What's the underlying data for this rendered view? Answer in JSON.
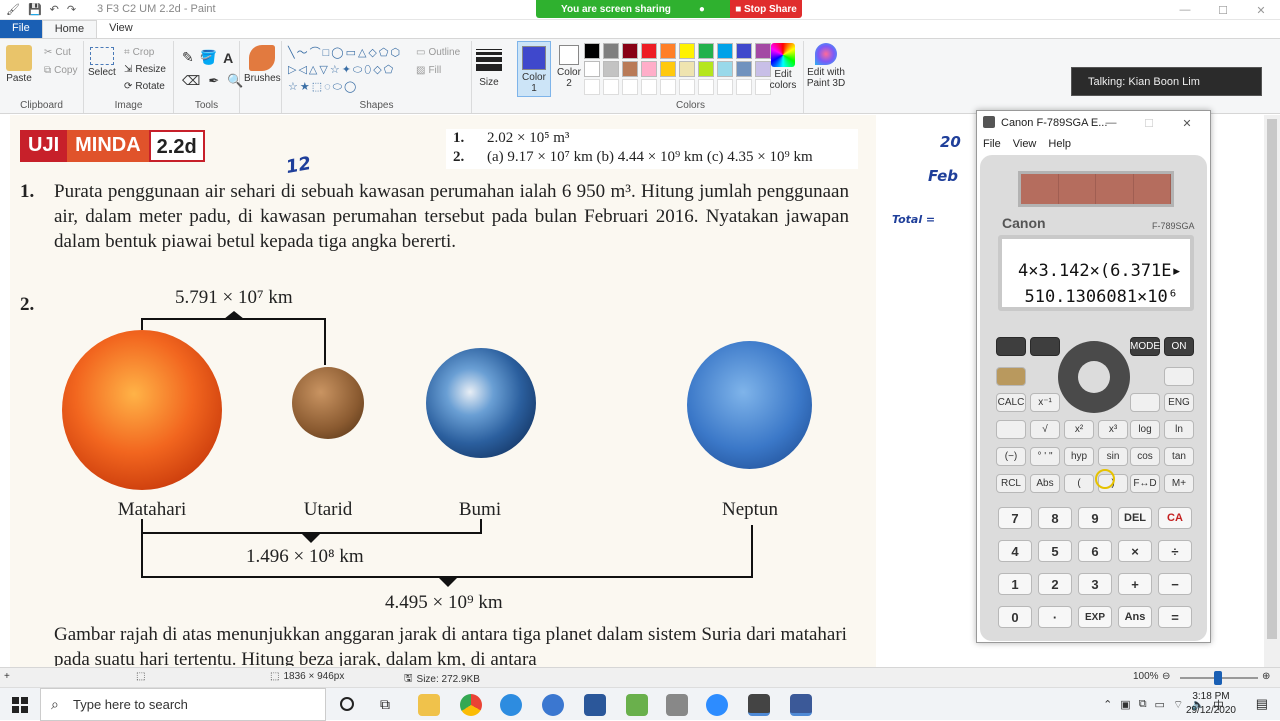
{
  "window": {
    "title": "3 F3 C2 UM 2.2d - Paint",
    "controls": [
      "—",
      "☐",
      "✕"
    ]
  },
  "screen_share": {
    "status": "You are screen sharing",
    "stop_label": "Stop Share"
  },
  "tabs": [
    "File",
    "Home",
    "View"
  ],
  "ribbon": {
    "clipboard": {
      "label": "Clipboard",
      "paste": "Paste",
      "cut": "Cut",
      "copy": "Copy"
    },
    "image": {
      "label": "Image",
      "select": "Select",
      "crop": "Crop",
      "resize": "Resize",
      "rotate": "Rotate"
    },
    "tools": {
      "label": "Tools"
    },
    "brushes": "Brushes",
    "shapes": {
      "label": "Shapes",
      "outline": "Outline",
      "fill": "Fill"
    },
    "size": "Size",
    "color1": "Color\n1",
    "color2": "Color\n2",
    "colors": {
      "label": "Colors",
      "edit": "Edit colors",
      "paint3d": "Edit with Paint 3D"
    },
    "palette": [
      "#000000",
      "#7f7f7f",
      "#880015",
      "#ed1c24",
      "#ff7f27",
      "#fff200",
      "#22b14c",
      "#00a2e8",
      "#3f48cc",
      "#a349a4",
      "#ffffff",
      "#c3c3c3",
      "#b97a57",
      "#ffaec9",
      "#ffc90e",
      "#efe4b0",
      "#b5e61d",
      "#99d9ea",
      "#7092be",
      "#c8bfe7",
      "#ffffff",
      "#ffffff",
      "#ffffff",
      "#ffffff",
      "#ffffff",
      "#ffffff",
      "#ffffff",
      "#ffffff",
      "#ffffff",
      "#ffffff"
    ],
    "color1_value": "#3f48cc"
  },
  "talking": "Talking: Kian Boon Lim",
  "document": {
    "badge": {
      "a": "UJI",
      "b": "MINDA",
      "c": "2.2d"
    },
    "answers": {
      "line1_num": "1.",
      "line1": "2.02 × 10⁵ m³",
      "line2_num": "2.",
      "line2": "(a) 9.17 × 10⁷ km   (b) 4.44 × 10⁹ km   (c) 4.35 × 10⁹ km"
    },
    "q1": {
      "num": "1.",
      "text": "Purata penggunaan air sehari di sebuah kawasan perumahan ialah 6 950 m³. Hitung jumlah penggunaan air, dalam meter padu, di kawasan perumahan tersebut pada bulan Februari 2016. Nyatakan jawapan dalam bentuk piawai betul kepada tiga angka bererti."
    },
    "q2": {
      "num": "2.",
      "dist_top": "5.791 × 10⁷ km",
      "dist_mid": "1.496 × 10⁸ km",
      "dist_bottom": "4.495 × 10⁹ km",
      "planets": [
        "Matahari",
        "Utarid",
        "Bumi",
        "Neptun"
      ],
      "text": "Gambar rajah di atas menunjukkan anggaran jarak di antara tiga planet dalam sistem Suria dari matahari pada suatu hari tertentu. Hitung beza jarak, dalam km, di antara"
    },
    "handwriting": {
      "hw1": "12",
      "hw2": "20",
      "hw3": "Feb",
      "hw4": "Total ="
    }
  },
  "calculator": {
    "title": "Canon F-789SGA E...",
    "menu": [
      "File",
      "View",
      "Help"
    ],
    "brand": "Canon",
    "model": "F-789SGA",
    "display_line1": "4×3.142×(6.371E▸",
    "display_line2": "510.1306081×10⁶",
    "rows": [
      [
        "CALC",
        "x⁻¹",
        "",
        "√",
        "log",
        "ln"
      ],
      [
        "√",
        "x²",
        "x³",
        "",
        "",
        ""
      ],
      [
        "(−)",
        "° ' \"",
        "hyp",
        "sin",
        "cos",
        "tan"
      ],
      [
        "RCL",
        "Abs",
        "(",
        ")",
        "F↔D",
        "M+"
      ]
    ],
    "top_keys": {
      "mode": "MODE",
      "on": "ON",
      "eng": "ENG"
    },
    "numpad": [
      [
        "7",
        "8",
        "9",
        "DEL",
        "CA"
      ],
      [
        "4",
        "5",
        "6",
        "×",
        "÷"
      ],
      [
        "1",
        "2",
        "3",
        "+",
        "−"
      ],
      [
        "0",
        "·",
        "EXP",
        "Ans",
        "="
      ]
    ]
  },
  "statusbar": {
    "dimensions": "1836 × 946px",
    "size": "Size: 272.9KB",
    "zoom": "100%"
  },
  "taskbar": {
    "search_placeholder": "Type here to search",
    "time": "3:18 PM",
    "date": "29/12/2020"
  }
}
